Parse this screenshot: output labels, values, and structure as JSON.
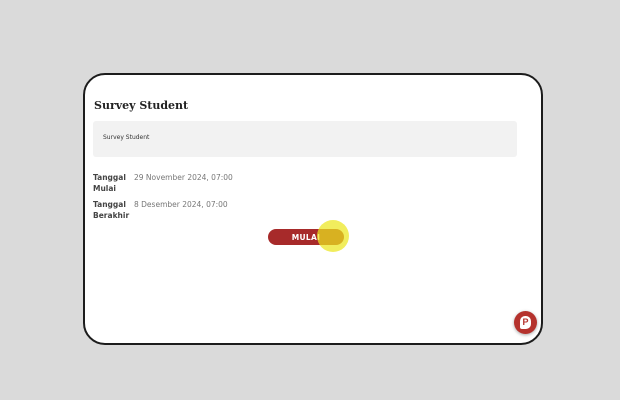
{
  "survey": {
    "title": "Survey Student",
    "description": "Survey Student"
  },
  "schedule": {
    "start_label": "Tanggal Mulai",
    "start_value": "29 November 2024, 07:00",
    "end_label": "Tanggal Berakhir",
    "end_value": "8 Desember 2024, 07:00"
  },
  "actions": {
    "start_button_label": "MULAI"
  },
  "floating_button": {
    "icon": "chat-p-icon",
    "glyph": "P"
  },
  "colors": {
    "accent": "#a72a2a",
    "background": "#dadada",
    "highlight": "#ebe61e"
  }
}
